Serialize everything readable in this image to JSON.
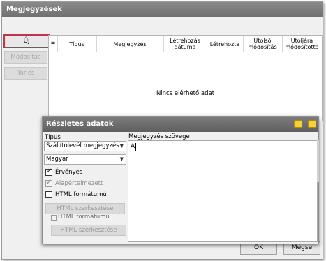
{
  "window": {
    "title": "Megjegyzések"
  },
  "side_buttons": {
    "new": "Új",
    "modify": "Módosítás",
    "delete": "Törlés"
  },
  "grid": {
    "columns": [
      "Típus",
      "Megjegyzés",
      "Létrehozás dátuma",
      "Létrehozta",
      "Utolsó módosítás",
      "Utoljára módosította"
    ],
    "empty_message": "Nincs elérhető adat",
    "splitter": "........"
  },
  "detail": {
    "title": "Részletes adatok",
    "type_label": "Típus",
    "type_value": "Szállítólevél megjegyzés",
    "language_value": "Magyar",
    "valid_label": "Érvényes",
    "default_label": "Alapértelmezett",
    "html_format_label": "HTML formátumú",
    "html_edit_label": "HTML szerkesztése",
    "ghost_html_format_label": "HTML formátumú",
    "ghost_html_edit_label": "HTML szerkesztése",
    "note_text_label": "Megjegyzés szövege",
    "note_text_value": "A"
  },
  "footer": {
    "ok": "OK",
    "cancel": "Mégse"
  }
}
